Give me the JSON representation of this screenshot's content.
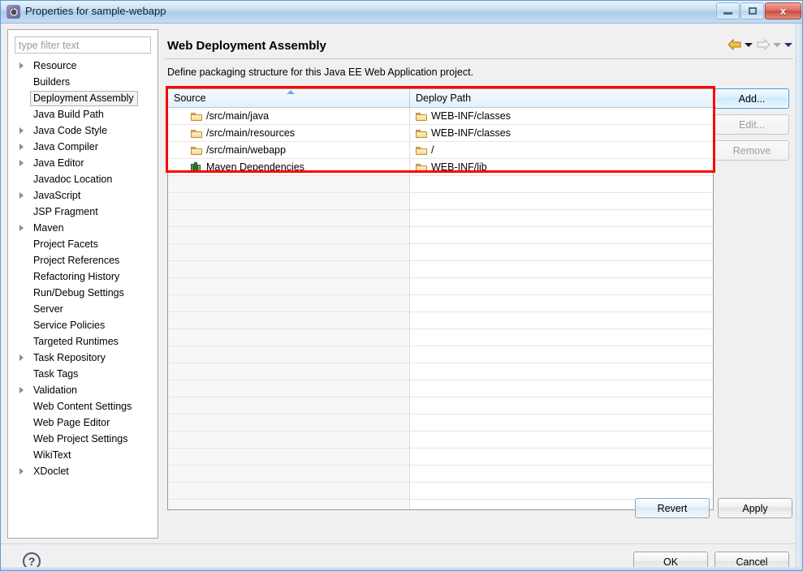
{
  "window": {
    "title": "Properties for sample-webapp",
    "icon": "gear-icon",
    "minimize_label": "",
    "maximize_label": "",
    "close_label": "x"
  },
  "sidebar": {
    "filter": {
      "value": "",
      "placeholder": "type filter text"
    },
    "items": [
      {
        "label": "Resource",
        "expandable": true,
        "selected": false
      },
      {
        "label": "Builders",
        "expandable": false,
        "selected": false
      },
      {
        "label": "Deployment Assembly",
        "expandable": false,
        "selected": true
      },
      {
        "label": "Java Build Path",
        "expandable": false,
        "selected": false
      },
      {
        "label": "Java Code Style",
        "expandable": true,
        "selected": false
      },
      {
        "label": "Java Compiler",
        "expandable": true,
        "selected": false
      },
      {
        "label": "Java Editor",
        "expandable": true,
        "selected": false
      },
      {
        "label": "Javadoc Location",
        "expandable": false,
        "selected": false
      },
      {
        "label": "JavaScript",
        "expandable": true,
        "selected": false
      },
      {
        "label": "JSP Fragment",
        "expandable": false,
        "selected": false
      },
      {
        "label": "Maven",
        "expandable": true,
        "selected": false
      },
      {
        "label": "Project Facets",
        "expandable": false,
        "selected": false
      },
      {
        "label": "Project References",
        "expandable": false,
        "selected": false
      },
      {
        "label": "Refactoring History",
        "expandable": false,
        "selected": false
      },
      {
        "label": "Run/Debug Settings",
        "expandable": false,
        "selected": false
      },
      {
        "label": "Server",
        "expandable": false,
        "selected": false
      },
      {
        "label": "Service Policies",
        "expandable": false,
        "selected": false
      },
      {
        "label": "Targeted Runtimes",
        "expandable": false,
        "selected": false
      },
      {
        "label": "Task Repository",
        "expandable": true,
        "selected": false
      },
      {
        "label": "Task Tags",
        "expandable": false,
        "selected": false
      },
      {
        "label": "Validation",
        "expandable": true,
        "selected": false
      },
      {
        "label": "Web Content Settings",
        "expandable": false,
        "selected": false
      },
      {
        "label": "Web Page Editor",
        "expandable": false,
        "selected": false
      },
      {
        "label": "Web Project Settings",
        "expandable": false,
        "selected": false
      },
      {
        "label": "WikiText",
        "expandable": false,
        "selected": false
      },
      {
        "label": "XDoclet",
        "expandable": true,
        "selected": false
      }
    ]
  },
  "page": {
    "title": "Web Deployment Assembly",
    "description": "Define packaging structure for this Java EE Web Application project.",
    "nav": {
      "back_icon": "back-arrow-icon",
      "back_menu_icon": "chevron-down-icon",
      "forward_icon": "forward-arrow-icon",
      "forward_menu_icon": "chevron-down-icon",
      "more_menu_icon": "chevron-down-icon"
    }
  },
  "table": {
    "columns": [
      "Source",
      "Deploy Path"
    ],
    "sort_column": "Source",
    "sort_icon": "sort-ascending-icon",
    "rows": [
      {
        "source": "/src/main/java",
        "source_icon": "folder-icon",
        "deploy": "WEB-INF/classes",
        "deploy_icon": "folder-icon"
      },
      {
        "source": "/src/main/resources",
        "source_icon": "folder-icon",
        "deploy": "WEB-INF/classes",
        "deploy_icon": "folder-icon"
      },
      {
        "source": "/src/main/webapp",
        "source_icon": "folder-icon",
        "deploy": "/",
        "deploy_icon": "folder-icon"
      },
      {
        "source": "Maven Dependencies",
        "source_icon": "library-icon",
        "deploy": "WEB-INF/lib",
        "deploy_icon": "folder-icon"
      }
    ],
    "empty_row_count": 20
  },
  "side_buttons": [
    {
      "label": "Add...",
      "state": "focused"
    },
    {
      "label": "Edit...",
      "state": "disabled"
    },
    {
      "label": "Remove",
      "state": "disabled"
    }
  ],
  "page_buttons": {
    "revert": "Revert",
    "apply": "Apply"
  },
  "footer": {
    "help_icon": "help-icon",
    "help_label": "?",
    "ok": "OK",
    "cancel": "Cancel"
  },
  "annotation": {
    "highlight_color": "#ff0000"
  }
}
